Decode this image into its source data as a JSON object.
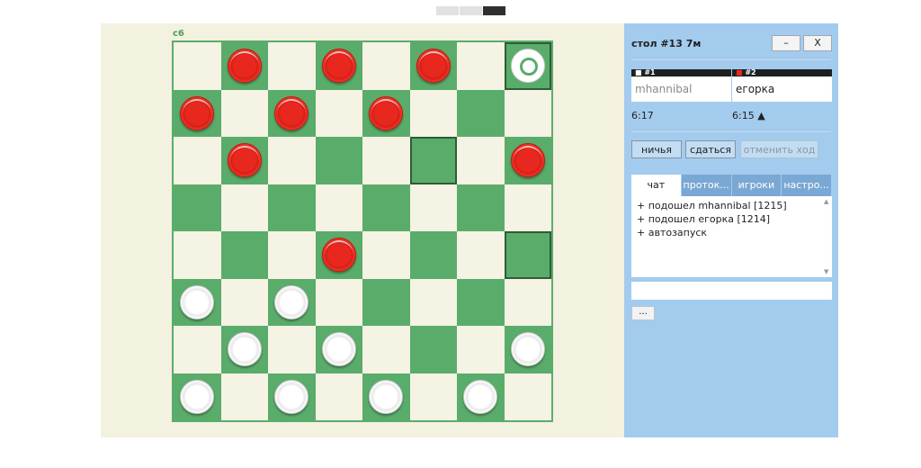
{
  "top_controls": [
    "",
    "",
    ""
  ],
  "board": {
    "coord_label": "c6",
    "pieces": {
      "0-1": "red",
      "0-3": "red",
      "0-5": "red",
      "0-7": "ghost",
      "1-0": "red",
      "1-2": "red",
      "1-4": "red",
      "2-1": "red",
      "2-7": "red",
      "4-3": "red",
      "5-0": "white",
      "5-2": "white",
      "6-1": "white",
      "6-3": "white",
      "6-7": "white",
      "7-0": "white",
      "7-2": "white",
      "7-4": "white",
      "7-6": "white"
    },
    "highlighted": [
      "0-7",
      "2-5",
      "4-7"
    ]
  },
  "panel": {
    "table_title": "стол #13   7м",
    "minimize_label": "–",
    "close_label": "X",
    "player1": {
      "tag": "■ #1",
      "name": "mhannibal",
      "clock": "6:17"
    },
    "player2": {
      "tag": "■ #2",
      "name": "егорка",
      "clock": "6:15 ▲"
    },
    "draw_label": "ничья",
    "resign_label": "сдаться",
    "undo_label": "отменить ход",
    "tabs": [
      "чат",
      "проток...",
      "игроки",
      "настро..."
    ],
    "chat_lines": [
      "+ подошел mhannibal [1215]",
      "+ подошел егорка [1214]",
      "+ автозапуск"
    ],
    "chat_input_value": "",
    "more_label": "..."
  },
  "colors": {
    "board_dark": "#5aac6b",
    "board_light": "#f4f3e4",
    "panel_bg": "#a3cbee",
    "red_piece": "#e8281f",
    "player2_marker": "#e8281f"
  }
}
